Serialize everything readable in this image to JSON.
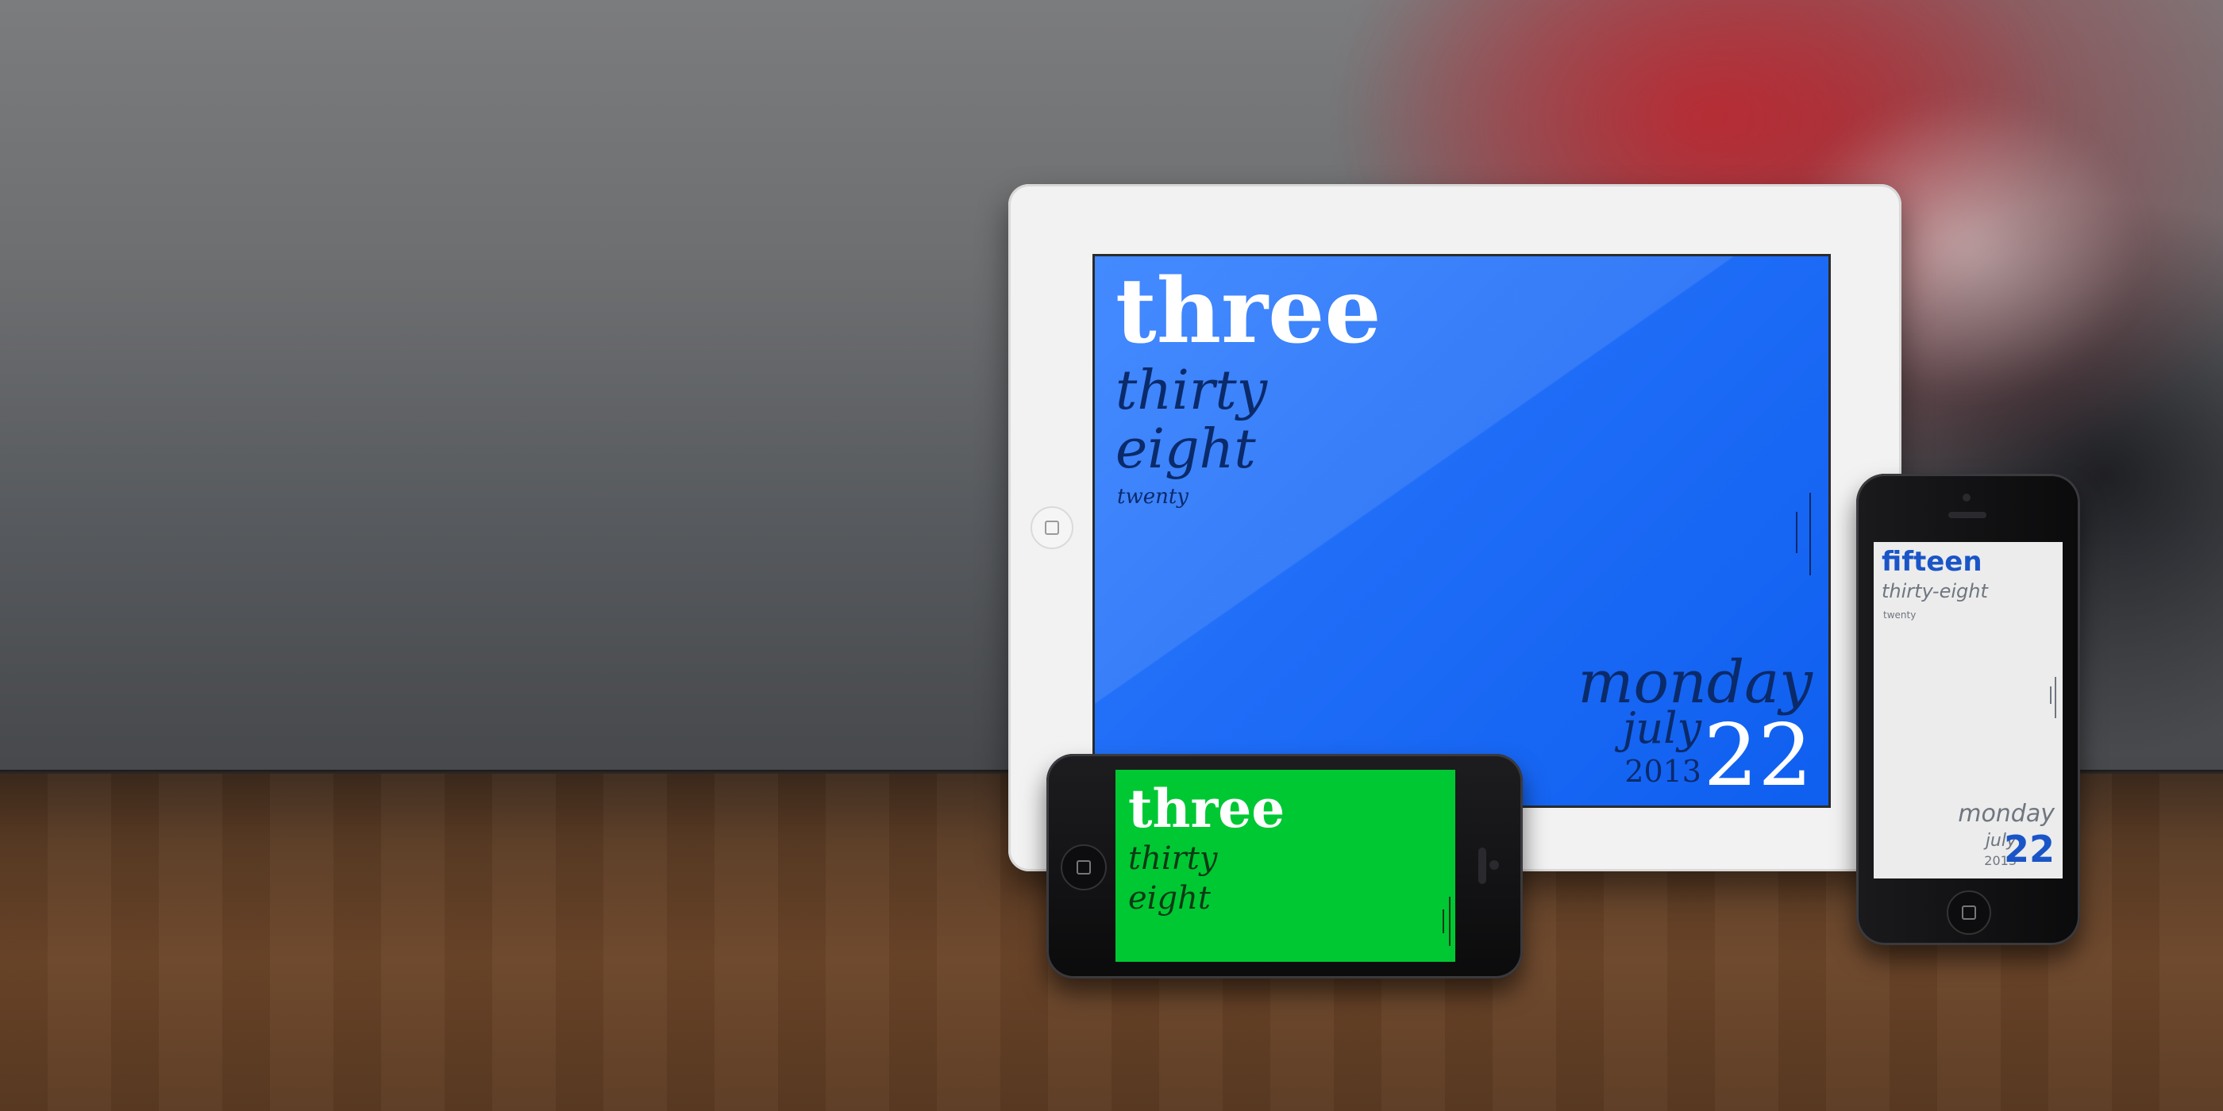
{
  "ipad": {
    "hour": "three",
    "minute": "thirty",
    "minute2": "eight",
    "second": "twenty",
    "weekday": "monday",
    "month": "july",
    "year": "2013",
    "day": "22",
    "background_color": "#1f6df7"
  },
  "phone_landscape": {
    "hour": "three",
    "minute": "thirty",
    "minute2": "eight",
    "background_color": "#00c833"
  },
  "phone_portrait": {
    "hour": "fifteen",
    "minute": "thirty-eight",
    "second": "twenty",
    "weekday": "monday",
    "month": "july",
    "year": "2013",
    "day": "22",
    "background_color": "#ececec",
    "accent_color": "#1a55c8"
  }
}
